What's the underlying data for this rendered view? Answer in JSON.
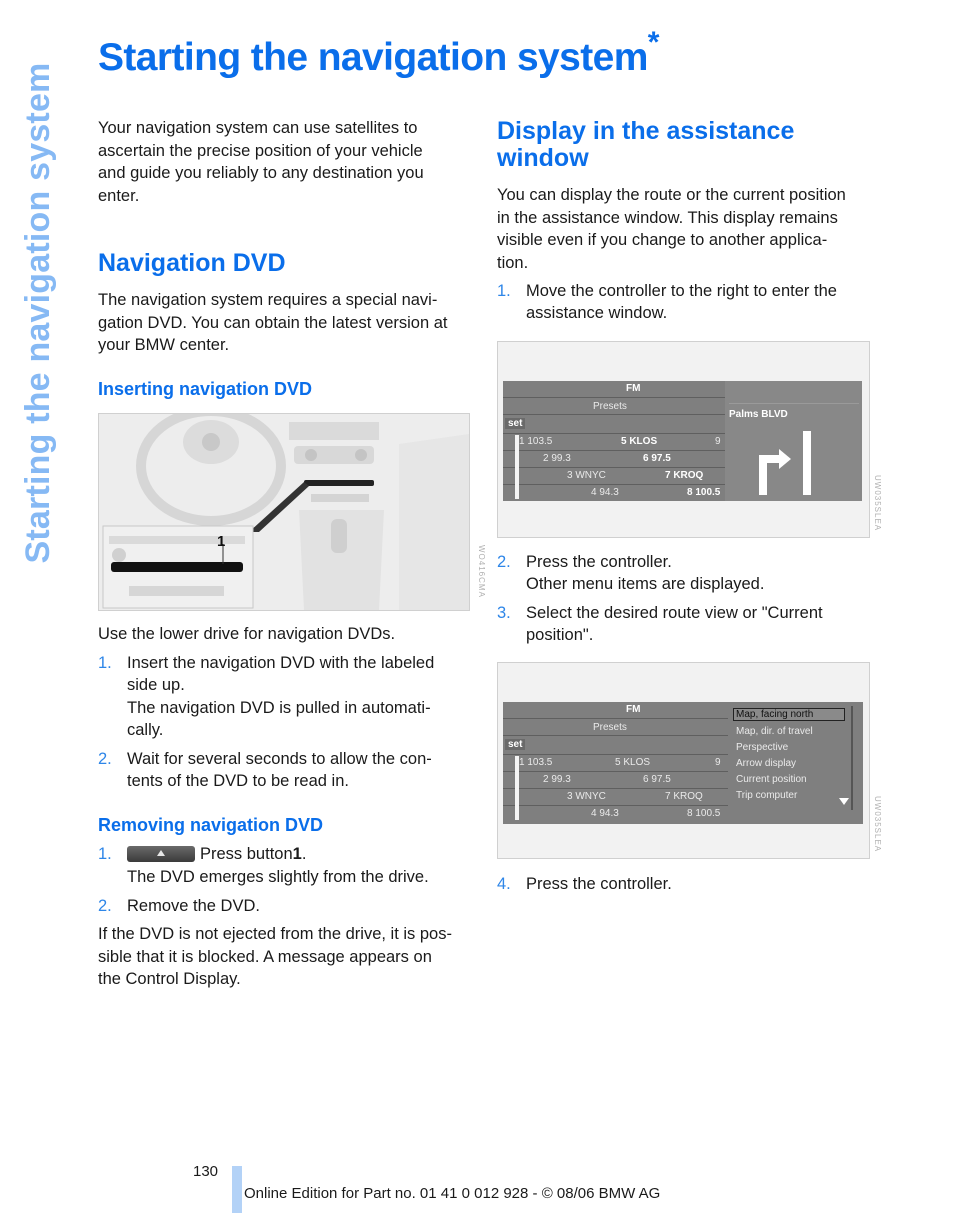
{
  "side_tab": "Starting the navigation system",
  "title": "Starting the navigation system",
  "title_marker": "*",
  "left": {
    "intro": [
      "Your navigation system can use satellites to",
      "ascertain the precise position of your vehicle",
      "and guide you reliably to any destination you",
      "enter."
    ],
    "section_heading": "Navigation DVD",
    "section_text": [
      "The navigation system requires a special navi-",
      "gation DVD. You can obtain the latest version at",
      "your BMW center."
    ],
    "inserting_heading": "Inserting navigation DVD",
    "figure1": {
      "callout": "1",
      "code": "WO416CMA",
      "icon": "car-dashboard-illustration"
    },
    "drive_note": "Use the lower drive for navigation DVDs.",
    "insert_steps": [
      {
        "num": "1.",
        "lines": [
          "Insert the navigation DVD with the labeled",
          "side up.",
          "The navigation DVD is pulled in automati-",
          "cally."
        ]
      },
      {
        "num": "2.",
        "lines": [
          "Wait for several seconds to allow the con-",
          "tents of the DVD to be read in."
        ]
      }
    ],
    "removing_heading": "Removing navigation DVD",
    "remove_steps": [
      {
        "num": "1.",
        "icon": "eject-button-icon",
        "text_pre": "Press button ",
        "text_bold": "1",
        "text_post": ".",
        "line2": "The DVD emerges slightly from the drive."
      },
      {
        "num": "2.",
        "lines": [
          "Remove the DVD."
        ]
      }
    ],
    "blocked_note": [
      "If the DVD is not ejected from the drive, it is pos-",
      "sible that it is blocked. A message appears on",
      "the Control Display."
    ]
  },
  "right": {
    "heading": [
      "Display in the assistance",
      "window"
    ],
    "text": [
      "You can display the route or the current position",
      "in the assistance window. This display remains",
      "visible even if you change to another applica-",
      "tion."
    ],
    "step1": {
      "num": "1.",
      "lines": [
        "Move the controller to the right to enter the",
        "assistance window."
      ]
    },
    "screen": {
      "band": "FM",
      "presets": "Presets",
      "set": "set",
      "stations": [
        {
          "a": "1 103.5",
          "b": "5 KLOS",
          "c": "9"
        },
        {
          "a": "2 99.3",
          "b": "6 97.5",
          "c": ""
        },
        {
          "a": "3 WNYC",
          "b": "7 KROQ",
          "c": ""
        },
        {
          "a": "4 94.3",
          "b": "8 100.5",
          "c": ""
        }
      ],
      "assist_street": "Palms BLVD",
      "menu_items": [
        "Map, facing north",
        "Map, dir. of travel",
        "Perspective",
        "Arrow display",
        "Current position",
        "Trip computer"
      ],
      "menu_selected": "Map, facing north",
      "code1": "UW035SLEA",
      "code2": "UW035SLEA"
    },
    "step2": {
      "num": "2.",
      "lines": [
        "Press the controller.",
        "Other menu items are displayed."
      ]
    },
    "step3": {
      "num": "3.",
      "lines": [
        "Select the desired route view or \"Current",
        "position\"."
      ]
    },
    "step4": {
      "num": "4.",
      "lines": [
        "Press the controller."
      ]
    }
  },
  "footer": {
    "page_number": "130",
    "text": "Online Edition for Part no. 01 41 0 012 928 - © 08/06 BMW AG"
  },
  "colors": {
    "accent": "#0a6eea",
    "tab": "#86b9f4",
    "footer_bar": "#b3d2f7"
  }
}
